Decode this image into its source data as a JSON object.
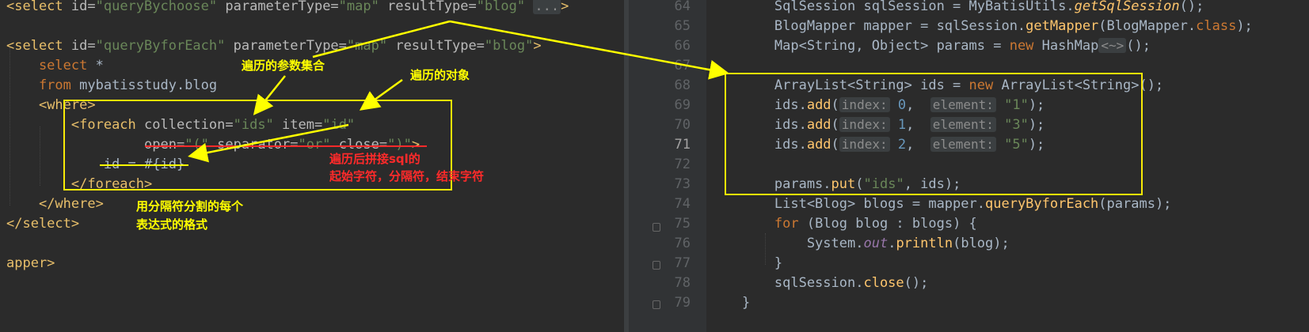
{
  "left": {
    "lines": [
      [
        [
          "t-tag",
          "<select"
        ],
        [
          "t-attr",
          " id="
        ],
        [
          "t-str",
          "\"queryBychoose\""
        ],
        [
          "t-attr",
          " parameterType="
        ],
        [
          "t-str",
          "\"map\""
        ],
        [
          "t-attr",
          " resultType="
        ],
        [
          "t-str",
          "\"blog\""
        ],
        [
          "t-plain",
          " "
        ],
        [
          "t-fold",
          "..."
        ],
        [
          "t-tag",
          ">"
        ]
      ],
      [],
      [
        [
          "t-tag",
          "<select"
        ],
        [
          "t-attr",
          " id="
        ],
        [
          "t-str",
          "\"queryByforEach\""
        ],
        [
          "t-attr",
          " parameterType="
        ],
        [
          "t-str",
          "\"map\""
        ],
        [
          "t-attr",
          " resultType="
        ],
        [
          "t-str",
          "\"blog\""
        ],
        [
          "t-tag",
          ">"
        ]
      ],
      [
        [
          "t-sql",
          "    select "
        ],
        [
          "t-plain",
          "*"
        ]
      ],
      [
        [
          "t-sql",
          "    from "
        ],
        [
          "t-plain",
          "mybatisstudy.blog"
        ]
      ],
      [
        [
          "t-plain",
          "    "
        ],
        [
          "t-tag",
          "<where>"
        ]
      ],
      [
        [
          "t-plain",
          "        "
        ],
        [
          "t-tag",
          "<foreach"
        ],
        [
          "t-attr",
          " collection="
        ],
        [
          "t-str",
          "\"ids\""
        ],
        [
          "t-attr",
          " item="
        ],
        [
          "t-str",
          "\"id\""
        ]
      ],
      [
        [
          "t-plain",
          "                 "
        ],
        [
          "t-attr",
          "open="
        ],
        [
          "t-str",
          "\"(\""
        ],
        [
          "t-attr",
          " separator="
        ],
        [
          "t-str",
          "\"or\""
        ],
        [
          "t-attr",
          " close="
        ],
        [
          "t-str",
          "\")\""
        ],
        [
          "t-tag",
          ">"
        ]
      ],
      [
        [
          "t-plain",
          "            id = "
        ],
        [
          "t-plain",
          "#{id}"
        ]
      ],
      [
        [
          "t-plain",
          "        "
        ],
        [
          "t-tag",
          "</foreach>"
        ]
      ],
      [
        [
          "t-plain",
          "    "
        ],
        [
          "t-tag",
          "</where>"
        ]
      ],
      [
        [
          "t-tag",
          "</select>"
        ]
      ],
      [],
      [
        [
          "t-tag",
          "apper>"
        ]
      ]
    ]
  },
  "right": {
    "line_numbers": [
      "64",
      "65",
      "66",
      "67",
      "68",
      "69",
      "70",
      "71",
      "72",
      "73",
      "74",
      "75",
      "76",
      "77",
      "78",
      "79"
    ],
    "active_line": "71",
    "lines": [
      [
        [
          "t-plain",
          "        SqlSession sqlSession = MyBatisUtils."
        ],
        [
          "t-it",
          "getSqlSession"
        ],
        [
          "t-plain",
          "();"
        ]
      ],
      [
        [
          "t-plain",
          "        BlogMapper mapper = sqlSession."
        ],
        [
          "t-fn",
          "getMapper"
        ],
        [
          "t-plain",
          "(BlogMapper."
        ],
        [
          "t-kw",
          "class"
        ],
        [
          "t-plain",
          ");"
        ]
      ],
      [
        [
          "t-plain",
          "        Map<String, Object> params = "
        ],
        [
          "t-kw",
          "new "
        ],
        [
          "t-plain",
          "HashMap"
        ],
        [
          "t-hint",
          "<~>"
        ],
        [
          "t-plain",
          "();"
        ]
      ],
      [],
      [
        [
          "t-plain",
          "        ArrayList<String> ids = "
        ],
        [
          "t-kw",
          "new "
        ],
        [
          "t-plain",
          "ArrayList<String>();"
        ]
      ],
      [
        [
          "t-plain",
          "        ids."
        ],
        [
          "t-fn",
          "add"
        ],
        [
          "t-plain",
          "("
        ],
        [
          "t-hint",
          "index:"
        ],
        [
          "t-num",
          " 0"
        ],
        [
          "t-plain",
          ",  "
        ],
        [
          "t-hint",
          "element:"
        ],
        [
          "t-str",
          " \"1\""
        ],
        [
          "t-plain",
          ");"
        ]
      ],
      [
        [
          "t-plain",
          "        ids."
        ],
        [
          "t-fn",
          "add"
        ],
        [
          "t-plain",
          "("
        ],
        [
          "t-hint",
          "index:"
        ],
        [
          "t-num",
          " 1"
        ],
        [
          "t-plain",
          ",  "
        ],
        [
          "t-hint",
          "element:"
        ],
        [
          "t-str",
          " \"3\""
        ],
        [
          "t-plain",
          ");"
        ]
      ],
      [
        [
          "t-plain",
          "        ids."
        ],
        [
          "t-fn",
          "add"
        ],
        [
          "t-plain",
          "("
        ],
        [
          "t-hint",
          "index:"
        ],
        [
          "t-num",
          " 2"
        ],
        [
          "t-plain",
          ",  "
        ],
        [
          "t-hint",
          "element:"
        ],
        [
          "t-str",
          " \"5\""
        ],
        [
          "t-plain",
          ");"
        ]
      ],
      [],
      [
        [
          "t-plain",
          "        params."
        ],
        [
          "t-fn",
          "put"
        ],
        [
          "t-plain",
          "("
        ],
        [
          "t-str",
          "\"ids\""
        ],
        [
          "t-plain",
          ", ids);"
        ]
      ],
      [
        [
          "t-plain",
          "        List<Blog> blogs = mapper."
        ],
        [
          "t-fn",
          "queryByforEach"
        ],
        [
          "t-plain",
          "(params);"
        ]
      ],
      [
        [
          "t-plain",
          "        "
        ],
        [
          "t-kw",
          "for "
        ],
        [
          "t-plain",
          "(Blog blog : blogs) {"
        ]
      ],
      [
        [
          "t-plain",
          "            System."
        ],
        [
          "t-out",
          "out"
        ],
        [
          "t-plain",
          "."
        ],
        [
          "t-fn",
          "println"
        ],
        [
          "t-plain",
          "(blog);"
        ]
      ],
      [
        [
          "t-plain",
          "        }"
        ]
      ],
      [
        [
          "t-plain",
          "        sqlSession."
        ],
        [
          "t-fn",
          "close"
        ],
        [
          "t-plain",
          "();"
        ]
      ],
      [
        [
          "t-plain",
          "    }"
        ]
      ]
    ]
  },
  "annotations": {
    "param_collection": "遍历的参数集合",
    "iterated_object": "遍历的对象",
    "sql_concat_line1": "遍历后拼接sql的",
    "sql_concat_line2": "起始字符，分隔符，结束字符",
    "expr_format_line1": "用分隔符分割的每个",
    "expr_format_line2": "表达式的格式"
  },
  "colors": {
    "annotation_yellow": "#ffff00",
    "annotation_red": "#ff2a2a",
    "editor_bg": "#2b2b2b"
  }
}
